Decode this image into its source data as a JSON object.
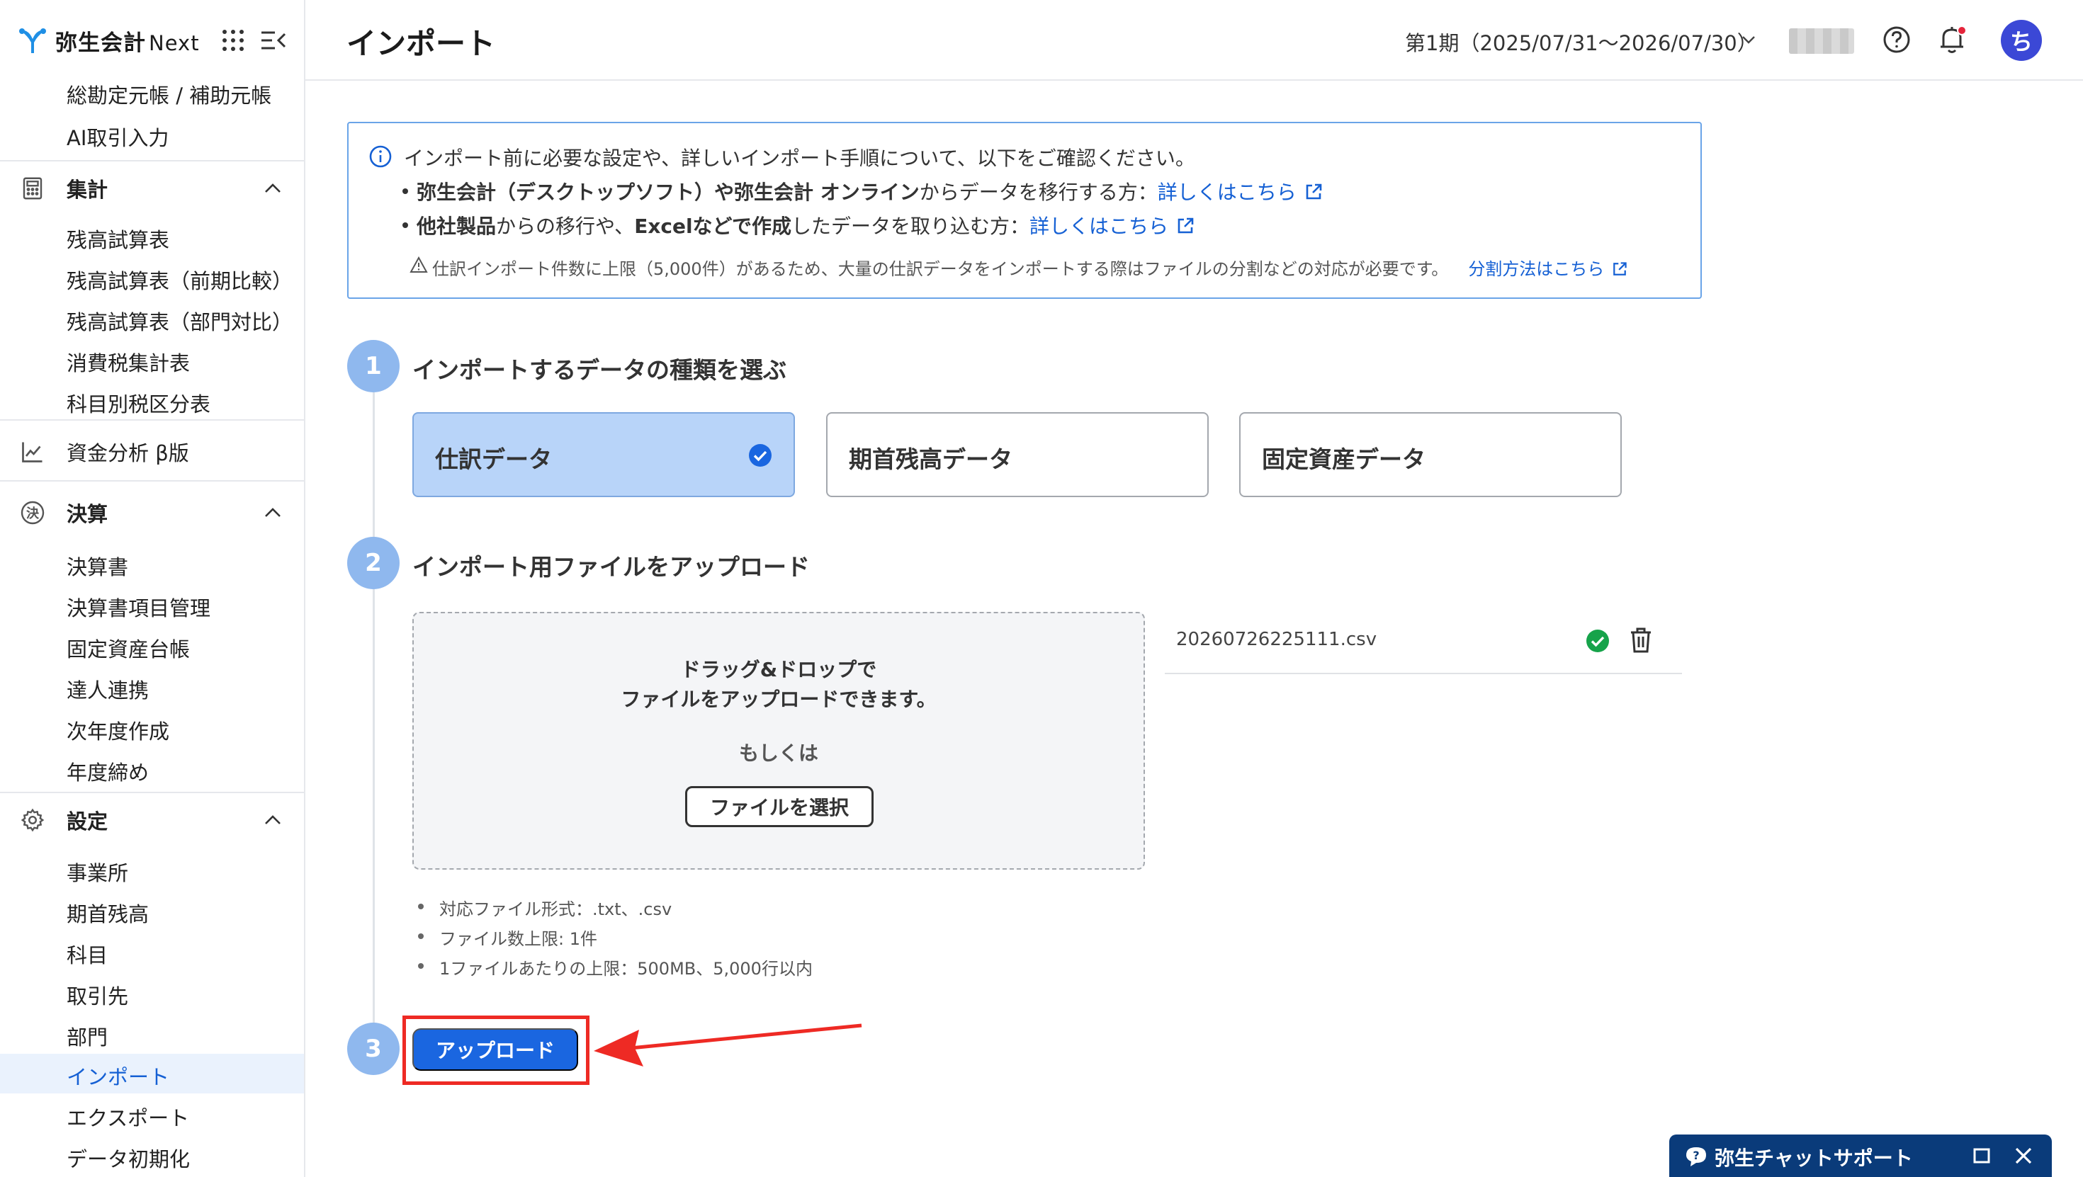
{
  "app": {
    "logo_text": "弥生会計",
    "logo_suffix": "Next"
  },
  "header": {
    "title": "インポート",
    "period": "第1期（2025/07/31〜2026/07/30）",
    "avatar_initial": "ち"
  },
  "sidebar": {
    "top_items": [
      "総勘定元帳 / 補助元帳",
      "AI取引入力"
    ],
    "sections": [
      {
        "label": "集計",
        "icon": "calculator-icon",
        "expanded": true,
        "items": [
          "残高試算表",
          "残高試算表（前期比較）",
          "残高試算表（部門対比）",
          "消費税集計表",
          "科目別税区分表"
        ]
      },
      {
        "label": "資金分析 β版",
        "icon": "chart-line-icon",
        "expanded": false,
        "items": []
      },
      {
        "label": "決算",
        "icon": "settlement-icon",
        "expanded": true,
        "items": [
          "決算書",
          "決算書項目管理",
          "固定資産台帳",
          "達人連携",
          "次年度作成",
          "年度締め"
        ]
      },
      {
        "label": "設定",
        "icon": "gear-icon",
        "expanded": true,
        "items": [
          "事業所",
          "期首残高",
          "科目",
          "取引先",
          "部門",
          "インポート",
          "エクスポート",
          "データ初期化"
        ]
      }
    ],
    "active_item": "インポート"
  },
  "info": {
    "intro": "インポート前に必要な設定や、詳しいインポート手順について、以下をご確認ください。",
    "bullet1_bold": "弥生会計（デスクトップソフト）や弥生会計 オンライン",
    "bullet1_rest": "からデータを移行する方：",
    "bullet1_link": "詳しくはこちら",
    "bullet2_bold1": "他社製品",
    "bullet2_mid": "からの移行や、",
    "bullet2_bold2": "Excelなどで作成",
    "bullet2_rest": "したデータを取り込む方：",
    "bullet2_link": "詳しくはこちら",
    "note": "仕訳インポート件数に上限（5,000件）があるため、大量の仕訳データをインポートする際はファイルの分割などの対応が必要です。",
    "note_link": "分割方法はこちら"
  },
  "steps": [
    {
      "number": "1",
      "title": "インポートするデータの種類を選ぶ"
    },
    {
      "number": "2",
      "title": "インポート用ファイルをアップロード"
    },
    {
      "number": "3",
      "title": ""
    }
  ],
  "data_types": [
    {
      "label": "仕訳データ",
      "selected": true
    },
    {
      "label": "期首残高データ",
      "selected": false
    },
    {
      "label": "固定資産データ",
      "selected": false
    }
  ],
  "dropzone": {
    "line1": "ドラッグ&ドロップで",
    "line2": "ファイルをアップロードできます。",
    "or": "もしくは",
    "select_button": "ファイルを選択"
  },
  "uploaded_file": {
    "name": "20260726225111.csv",
    "status": "success"
  },
  "requirements": [
    "対応ファイル形式：.txt、.csv",
    "ファイル数上限: 1件",
    "1ファイルあたりの上限：500MB、5,000行以内"
  ],
  "upload_button": "アップロード",
  "chat": {
    "label": "弥生チャットサポート"
  },
  "colors": {
    "accent": "#1a66e0",
    "selected_card": "#b8d4f9",
    "step_circle": "#8fb8ee",
    "annotation_red": "#ee2a24",
    "chat_bar": "#0a3b7a"
  }
}
